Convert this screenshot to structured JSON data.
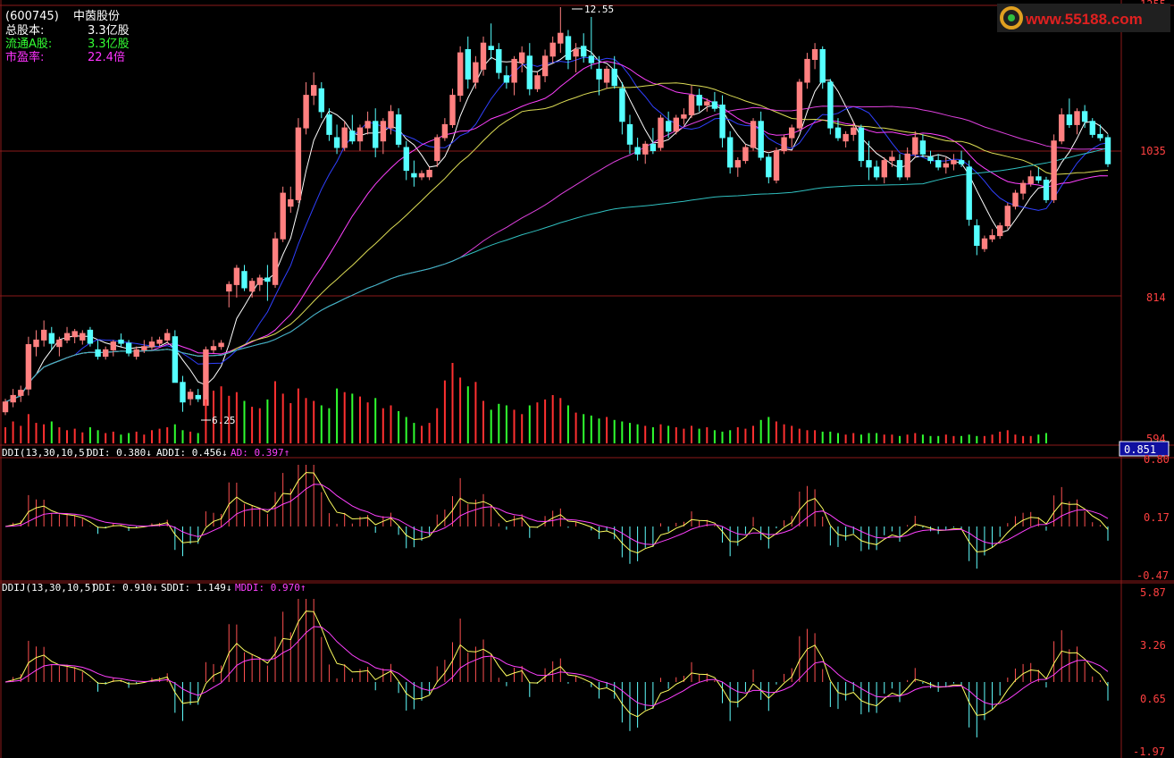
{
  "stock": {
    "code": "(600745)",
    "name": "中茵股份",
    "info": [
      {
        "label": "总股本:",
        "value": "3.3亿股",
        "color": "#ffffff"
      },
      {
        "label": "流通A股:",
        "value": "3.3亿股",
        "color": "#33ff33"
      },
      {
        "label": "市盈率:",
        "value": "22.4倍",
        "color": "#ff33ff"
      }
    ]
  },
  "watermark": "www.55188.com",
  "colors": {
    "up": "#ff8080",
    "down": "#55ffff",
    "volUp": "#ff3030",
    "volDown": "#30ff30",
    "grid": "#8b1a1a",
    "axisText": "#ff4040",
    "ma5": "#ffffff",
    "ma10": "#3040ff",
    "ma20": "#ff40ff",
    "ma30": "#dddd55",
    "ma60": "#dd40dd",
    "ma120": "#30c0c0",
    "ddi": "#ffff60",
    "addi": "#ff40ff",
    "ad": "#ff40ff",
    "barPos": "#ff5050",
    "barNeg": "#60ffff"
  },
  "price_panel": {
    "axis_labels": [
      "1255",
      "1035",
      "814",
      "594"
    ],
    "annotation_high": "12.55",
    "annotation_low": "6.25",
    "current_badge": "0.851"
  },
  "ddi_panel": {
    "title": "DDI(13,30,10,5)",
    "legend": [
      {
        "text": "DDI: 0.380↓",
        "key": "ddi"
      },
      {
        "text": "ADDI: 0.456↓",
        "key": "addi"
      },
      {
        "text": "AD: 0.397↑",
        "key": "ad"
      }
    ],
    "axis_labels": [
      "0.80",
      "0.17",
      "-0.47"
    ]
  },
  "ddij_panel": {
    "title": "DDIJ(13,30,10,5)",
    "legend": [
      {
        "text": "DDI: 0.910↓",
        "key": "ddi"
      },
      {
        "text": "SDDI: 1.149↓",
        "key": "ma30"
      },
      {
        "text": "MDDI: 0.970↑",
        "key": "addi"
      }
    ],
    "axis_labels": [
      "5.87",
      "3.26",
      "0.65",
      "-1.97"
    ]
  },
  "chart_data": {
    "type": "candlestick",
    "price_range": [
      5.94,
      12.55
    ],
    "high": 12.55,
    "low": 6.25,
    "ohlc": [
      [
        6.35,
        6.55,
        6.3,
        6.5
      ],
      [
        6.5,
        6.7,
        6.42,
        6.6
      ],
      [
        6.6,
        6.75,
        6.5,
        6.68
      ],
      [
        6.7,
        7.5,
        6.6,
        7.38
      ],
      [
        7.35,
        7.6,
        7.2,
        7.45
      ],
      [
        7.45,
        7.75,
        7.35,
        7.6
      ],
      [
        7.55,
        7.65,
        7.3,
        7.4
      ],
      [
        7.35,
        7.5,
        7.2,
        7.45
      ],
      [
        7.45,
        7.65,
        7.4,
        7.55
      ],
      [
        7.5,
        7.62,
        7.4,
        7.58
      ],
      [
        7.45,
        7.6,
        7.38,
        7.55
      ],
      [
        7.6,
        7.65,
        7.35,
        7.4
      ],
      [
        7.3,
        7.45,
        7.15,
        7.2
      ],
      [
        7.2,
        7.35,
        7.15,
        7.3
      ],
      [
        7.3,
        7.45,
        7.2,
        7.42
      ],
      [
        7.45,
        7.55,
        7.35,
        7.4
      ],
      [
        7.4,
        7.45,
        7.2,
        7.25
      ],
      [
        7.2,
        7.35,
        7.15,
        7.3
      ],
      [
        7.3,
        7.45,
        7.25,
        7.35
      ],
      [
        7.35,
        7.5,
        7.3,
        7.42
      ],
      [
        7.4,
        7.5,
        7.35,
        7.45
      ],
      [
        7.45,
        7.62,
        7.4,
        7.55
      ],
      [
        7.5,
        7.6,
        7.0,
        6.8
      ],
      [
        6.8,
        6.9,
        6.35,
        6.5
      ],
      [
        6.55,
        6.7,
        6.45,
        6.65
      ],
      [
        6.6,
        6.7,
        6.5,
        6.55
      ],
      [
        6.45,
        7.35,
        6.4,
        7.3
      ],
      [
        7.3,
        7.45,
        7.25,
        7.35
      ],
      [
        7.35,
        7.45,
        7.3,
        7.4
      ],
      [
        8.2,
        8.35,
        7.95,
        8.3
      ],
      [
        8.3,
        8.6,
        8.1,
        8.55
      ],
      [
        8.5,
        8.6,
        8.2,
        8.25
      ],
      [
        8.2,
        8.4,
        8.1,
        8.35
      ],
      [
        8.3,
        8.45,
        8.2,
        8.4
      ],
      [
        8.4,
        8.6,
        8.05,
        8.35
      ],
      [
        8.3,
        9.1,
        8.25,
        9.0
      ],
      [
        9.0,
        9.8,
        8.95,
        9.7
      ],
      [
        9.5,
        9.8,
        9.4,
        9.6
      ],
      [
        9.6,
        10.85,
        9.55,
        10.7
      ],
      [
        10.7,
        11.4,
        10.6,
        11.2
      ],
      [
        11.2,
        11.55,
        11.05,
        11.35
      ],
      [
        11.3,
        11.4,
        10.85,
        10.95
      ],
      [
        10.9,
        11.0,
        10.5,
        10.6
      ],
      [
        10.55,
        10.75,
        10.3,
        10.4
      ],
      [
        10.4,
        10.8,
        10.35,
        10.7
      ],
      [
        10.65,
        10.9,
        10.45,
        10.5
      ],
      [
        10.5,
        10.75,
        10.35,
        10.7
      ],
      [
        10.7,
        10.95,
        10.6,
        10.8
      ],
      [
        10.8,
        11.0,
        10.25,
        10.4
      ],
      [
        10.5,
        10.85,
        10.3,
        10.8
      ],
      [
        10.7,
        11.05,
        10.6,
        10.95
      ],
      [
        10.9,
        11.0,
        10.4,
        10.45
      ],
      [
        10.4,
        10.5,
        9.9,
        10.05
      ],
      [
        10.0,
        10.2,
        9.8,
        9.95
      ],
      [
        9.95,
        10.05,
        9.9,
        10.0
      ],
      [
        9.95,
        10.1,
        9.9,
        10.05
      ],
      [
        10.2,
        10.6,
        10.1,
        10.55
      ],
      [
        10.55,
        10.85,
        10.5,
        10.75
      ],
      [
        10.75,
        11.3,
        10.7,
        11.2
      ],
      [
        11.2,
        11.95,
        11.1,
        11.85
      ],
      [
        11.9,
        12.1,
        11.3,
        11.45
      ],
      [
        11.4,
        11.8,
        11.3,
        11.7
      ],
      [
        11.6,
        12.1,
        11.5,
        12.0
      ],
      [
        11.95,
        12.3,
        11.75,
        11.9
      ],
      [
        11.9,
        12.0,
        11.45,
        11.55
      ],
      [
        11.5,
        11.65,
        11.3,
        11.4
      ],
      [
        11.4,
        11.8,
        11.2,
        11.75
      ],
      [
        11.7,
        11.95,
        11.55,
        11.85
      ],
      [
        11.8,
        12.0,
        11.2,
        11.3
      ],
      [
        11.3,
        11.55,
        11.25,
        11.5
      ],
      [
        11.5,
        11.9,
        11.4,
        11.8
      ],
      [
        11.8,
        12.1,
        11.7,
        12.0
      ],
      [
        12.0,
        12.55,
        11.85,
        12.15
      ],
      [
        12.1,
        12.2,
        11.6,
        11.75
      ],
      [
        11.8,
        12.0,
        11.55,
        11.9
      ],
      [
        11.95,
        12.15,
        11.7,
        11.8
      ],
      [
        11.8,
        12.4,
        11.6,
        11.7
      ],
      [
        11.6,
        11.8,
        11.2,
        11.45
      ],
      [
        11.4,
        11.65,
        11.3,
        11.6
      ],
      [
        11.6,
        11.8,
        11.3,
        11.35
      ],
      [
        11.3,
        11.4,
        10.6,
        10.8
      ],
      [
        10.75,
        10.9,
        10.3,
        10.45
      ],
      [
        10.4,
        10.55,
        10.2,
        10.3
      ],
      [
        10.3,
        10.5,
        10.15,
        10.45
      ],
      [
        10.45,
        10.7,
        10.3,
        10.35
      ],
      [
        10.4,
        10.9,
        10.35,
        10.85
      ],
      [
        10.8,
        10.95,
        10.55,
        10.65
      ],
      [
        10.65,
        10.9,
        10.6,
        10.85
      ],
      [
        10.85,
        11.0,
        10.75,
        10.9
      ],
      [
        10.9,
        11.35,
        10.85,
        11.2
      ],
      [
        11.2,
        11.3,
        10.95,
        11.05
      ],
      [
        11.05,
        11.15,
        10.95,
        11.1
      ],
      [
        11.1,
        11.25,
        10.95,
        11.0
      ],
      [
        11.05,
        11.2,
        10.4,
        10.55
      ],
      [
        10.55,
        10.65,
        10.0,
        10.1
      ],
      [
        10.1,
        10.25,
        9.95,
        10.2
      ],
      [
        10.2,
        10.45,
        10.15,
        10.4
      ],
      [
        10.4,
        10.85,
        10.35,
        10.8
      ],
      [
        10.8,
        10.95,
        10.2,
        10.25
      ],
      [
        10.25,
        10.3,
        9.85,
        9.95
      ],
      [
        9.9,
        10.4,
        9.85,
        10.35
      ],
      [
        10.35,
        10.6,
        10.3,
        10.55
      ],
      [
        10.55,
        10.75,
        10.4,
        10.7
      ],
      [
        10.7,
        11.45,
        10.65,
        11.4
      ],
      [
        11.4,
        11.85,
        11.3,
        11.75
      ],
      [
        11.75,
        12.0,
        11.6,
        11.9
      ],
      [
        11.9,
        11.95,
        11.3,
        11.4
      ],
      [
        11.4,
        11.45,
        10.6,
        10.7
      ],
      [
        10.7,
        10.85,
        10.5,
        10.55
      ],
      [
        10.5,
        10.65,
        10.4,
        10.6
      ],
      [
        10.6,
        10.8,
        10.5,
        10.7
      ],
      [
        10.7,
        10.75,
        10.1,
        10.2
      ],
      [
        10.2,
        10.5,
        9.9,
        10.1
      ],
      [
        10.1,
        10.2,
        9.9,
        9.95
      ],
      [
        9.95,
        10.25,
        9.85,
        10.2
      ],
      [
        10.2,
        10.35,
        10.1,
        10.25
      ],
      [
        10.2,
        10.3,
        9.9,
        9.95
      ],
      [
        9.95,
        10.4,
        9.9,
        10.3
      ],
      [
        10.3,
        10.65,
        10.25,
        10.55
      ],
      [
        10.5,
        10.6,
        10.25,
        10.3
      ],
      [
        10.25,
        10.35,
        10.15,
        10.2
      ],
      [
        10.2,
        10.3,
        10.05,
        10.1
      ],
      [
        10.1,
        10.25,
        10.0,
        10.15
      ],
      [
        10.15,
        10.3,
        10.05,
        10.2
      ],
      [
        10.2,
        10.35,
        10.1,
        10.15
      ],
      [
        10.1,
        10.2,
        9.2,
        9.3
      ],
      [
        9.2,
        9.3,
        8.75,
        8.9
      ],
      [
        8.85,
        9.05,
        8.8,
        9.0
      ],
      [
        9.0,
        9.15,
        8.95,
        9.05
      ],
      [
        9.05,
        9.25,
        9.0,
        9.2
      ],
      [
        9.2,
        9.55,
        9.15,
        9.5
      ],
      [
        9.5,
        9.75,
        9.45,
        9.7
      ],
      [
        9.7,
        9.9,
        9.6,
        9.85
      ],
      [
        9.85,
        10.05,
        9.8,
        9.95
      ],
      [
        9.95,
        10.1,
        9.85,
        9.9
      ],
      [
        9.9,
        9.95,
        9.55,
        9.6
      ],
      [
        9.6,
        10.6,
        9.55,
        10.5
      ],
      [
        10.5,
        11.0,
        10.45,
        10.9
      ],
      [
        10.9,
        11.15,
        10.7,
        10.75
      ],
      [
        10.75,
        11.0,
        10.6,
        10.95
      ],
      [
        10.95,
        11.05,
        10.7,
        10.8
      ],
      [
        10.8,
        10.85,
        10.55,
        10.6
      ],
      [
        10.6,
        10.75,
        10.5,
        10.55
      ],
      [
        10.55,
        10.6,
        10.1,
        10.15
      ]
    ],
    "volume": [
      22,
      30,
      24,
      40,
      28,
      26,
      30,
      22,
      18,
      20,
      15,
      22,
      18,
      14,
      16,
      12,
      14,
      16,
      12,
      18,
      20,
      22,
      26,
      18,
      16,
      14,
      60,
      72,
      78,
      65,
      70,
      58,
      50,
      48,
      60,
      85,
      68,
      55,
      75,
      62,
      58,
      52,
      48,
      75,
      70,
      68,
      64,
      56,
      62,
      48,
      52,
      44,
      36,
      28,
      24,
      28,
      48,
      86,
      110,
      90,
      78,
      84,
      58,
      46,
      54,
      52,
      46,
      40,
      52,
      56,
      60,
      66,
      62,
      52,
      42,
      40,
      38,
      34,
      36,
      32,
      30,
      28,
      26,
      24,
      22,
      26,
      24,
      22,
      20,
      24,
      20,
      22,
      18,
      16,
      18,
      22,
      20,
      24,
      32,
      36,
      30,
      26,
      24,
      20,
      18,
      18,
      16,
      16,
      14,
      12,
      14,
      12,
      14,
      14,
      12,
      12,
      10,
      12,
      14,
      12,
      10,
      10,
      12,
      10,
      10,
      12,
      10,
      10,
      12,
      16,
      18,
      12,
      10,
      10,
      12,
      14
    ]
  }
}
